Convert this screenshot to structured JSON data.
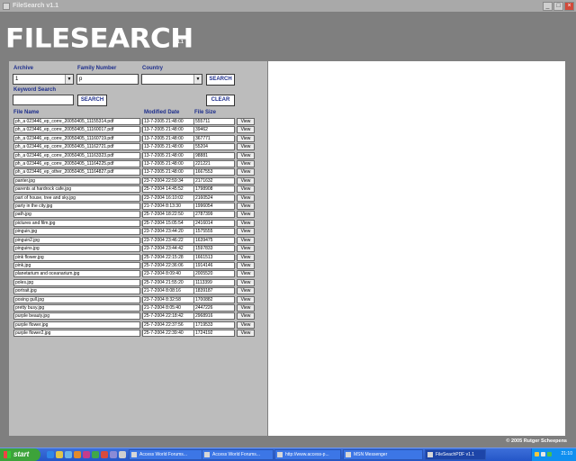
{
  "window": {
    "title": "FileSearch v1.1",
    "controls": [
      "_",
      "□",
      "×"
    ]
  },
  "header": {
    "logo": "FILESEARCH",
    "version": "v1.1"
  },
  "form": {
    "archive_label": "Archive",
    "archive_value": "1",
    "family_label": "Family Number",
    "family_value": "p",
    "country_label": "Country",
    "country_value": "",
    "search_label": "SEARCH",
    "keyword_label": "Keyword Search",
    "keyword_value": "",
    "keyword_search_label": "SEARCH",
    "clear_label": "CLEAR"
  },
  "table": {
    "headers": {
      "name": "File Name",
      "date": "Modified Date",
      "size": "File Size"
    },
    "view_label": "View",
    "rows": [
      [
        "ph_a 023446_ep_corre_20050405_11155314.pdf",
        "13-7-2005 21:48:00",
        "555711"
      ],
      [
        "ph_a 023446_ep_corre_20050405_11160017.pdf",
        "13-7-2005 21:48:00",
        "39462"
      ],
      [
        "ph_a 023446_ep_corre_20050405_11160719.pdf",
        "13-7-2005 21:48:00",
        "367771"
      ],
      [
        "ph_a 023446_ep_corre_20050405_11162721.pdf",
        "13-7-2005 21:48:00",
        "55204"
      ],
      [
        "ph_a 023446_ep_corre_20050405_11163323.pdf",
        "13-7-2005 21:48:00",
        "98881"
      ],
      [
        "ph_a 023446_ep_corre_20050405_11164225.pdf",
        "13-7-2005 21:48:00",
        "221221"
      ],
      [
        "ph_a 023446_ep_other_20050405_11164827.pdf",
        "13-7-2005 21:48:00",
        "1667553"
      ],
      [
        "panter.jpg",
        "23-7-2004 22:59:34",
        "2171632"
      ],
      [
        "parents at hardrock cafe.jpg",
        "25-7-2004 14:45:52",
        "1798908"
      ],
      [
        "part of house, tree and sky.jpg",
        "23-7-2004 16:10:02",
        "2160524"
      ],
      [
        "party in the city.jpg",
        "21-7-2004 8:13:30",
        "1996054"
      ],
      [
        "path.jpg",
        "25-7-2004 18:22:50",
        "2787399"
      ],
      [
        "pictures and film.jpg",
        "25-7-2004 15:05:54",
        "2416014"
      ],
      [
        "pinguin.jpg",
        "23-7-2004 23:44:20",
        "1575555"
      ],
      [
        "pinguin2.jpg",
        "23-7-2004 23:46:22",
        "1639475"
      ],
      [
        "pinguins.jpg",
        "23-7-2004 23:44:42",
        "1597833"
      ],
      [
        "pink flower.jpg",
        "25-7-2004 22:15:28",
        "1661513"
      ],
      [
        "pink.jpg",
        "25-7-2004 22:36:06",
        "1914146"
      ],
      [
        "planetarium and oceanarium.jpg",
        "23-7-2004 8:09:40",
        "2005520"
      ],
      [
        "poles.jpg",
        "25-7-2004 21:55:20",
        "1113399"
      ],
      [
        "portrait.jpg",
        "21-7-2004 8:08:16",
        "1839187"
      ],
      [
        "posing gull.jpg",
        "23-7-2004 8:32:58",
        "1700882"
      ],
      [
        "pretty busy.jpg",
        "21-7-2004 8:05:40",
        "2447226"
      ],
      [
        "purple beauty.jpg",
        "25-7-2004 22:18:42",
        "2968916"
      ],
      [
        "purple flower.jpg",
        "25-7-2004 22:37:56",
        "1719533"
      ],
      [
        "purple flower2.jpg",
        "25-7-2004 22:39:40",
        "1724192"
      ]
    ]
  },
  "footer": {
    "copyright": "© 2005 Rutger Scheepens"
  },
  "taskbar": {
    "start_label": "start",
    "buttons": [
      {
        "label": "Access World Forums...",
        "active": false
      },
      {
        "label": "Access World Forums...",
        "active": false
      },
      {
        "label": "http://www.access-p...",
        "active": false
      },
      {
        "label": "MSN Messenger",
        "active": false
      },
      {
        "label": "FileSeachPDF v1.1",
        "active": true
      }
    ],
    "clock": "21:10"
  }
}
